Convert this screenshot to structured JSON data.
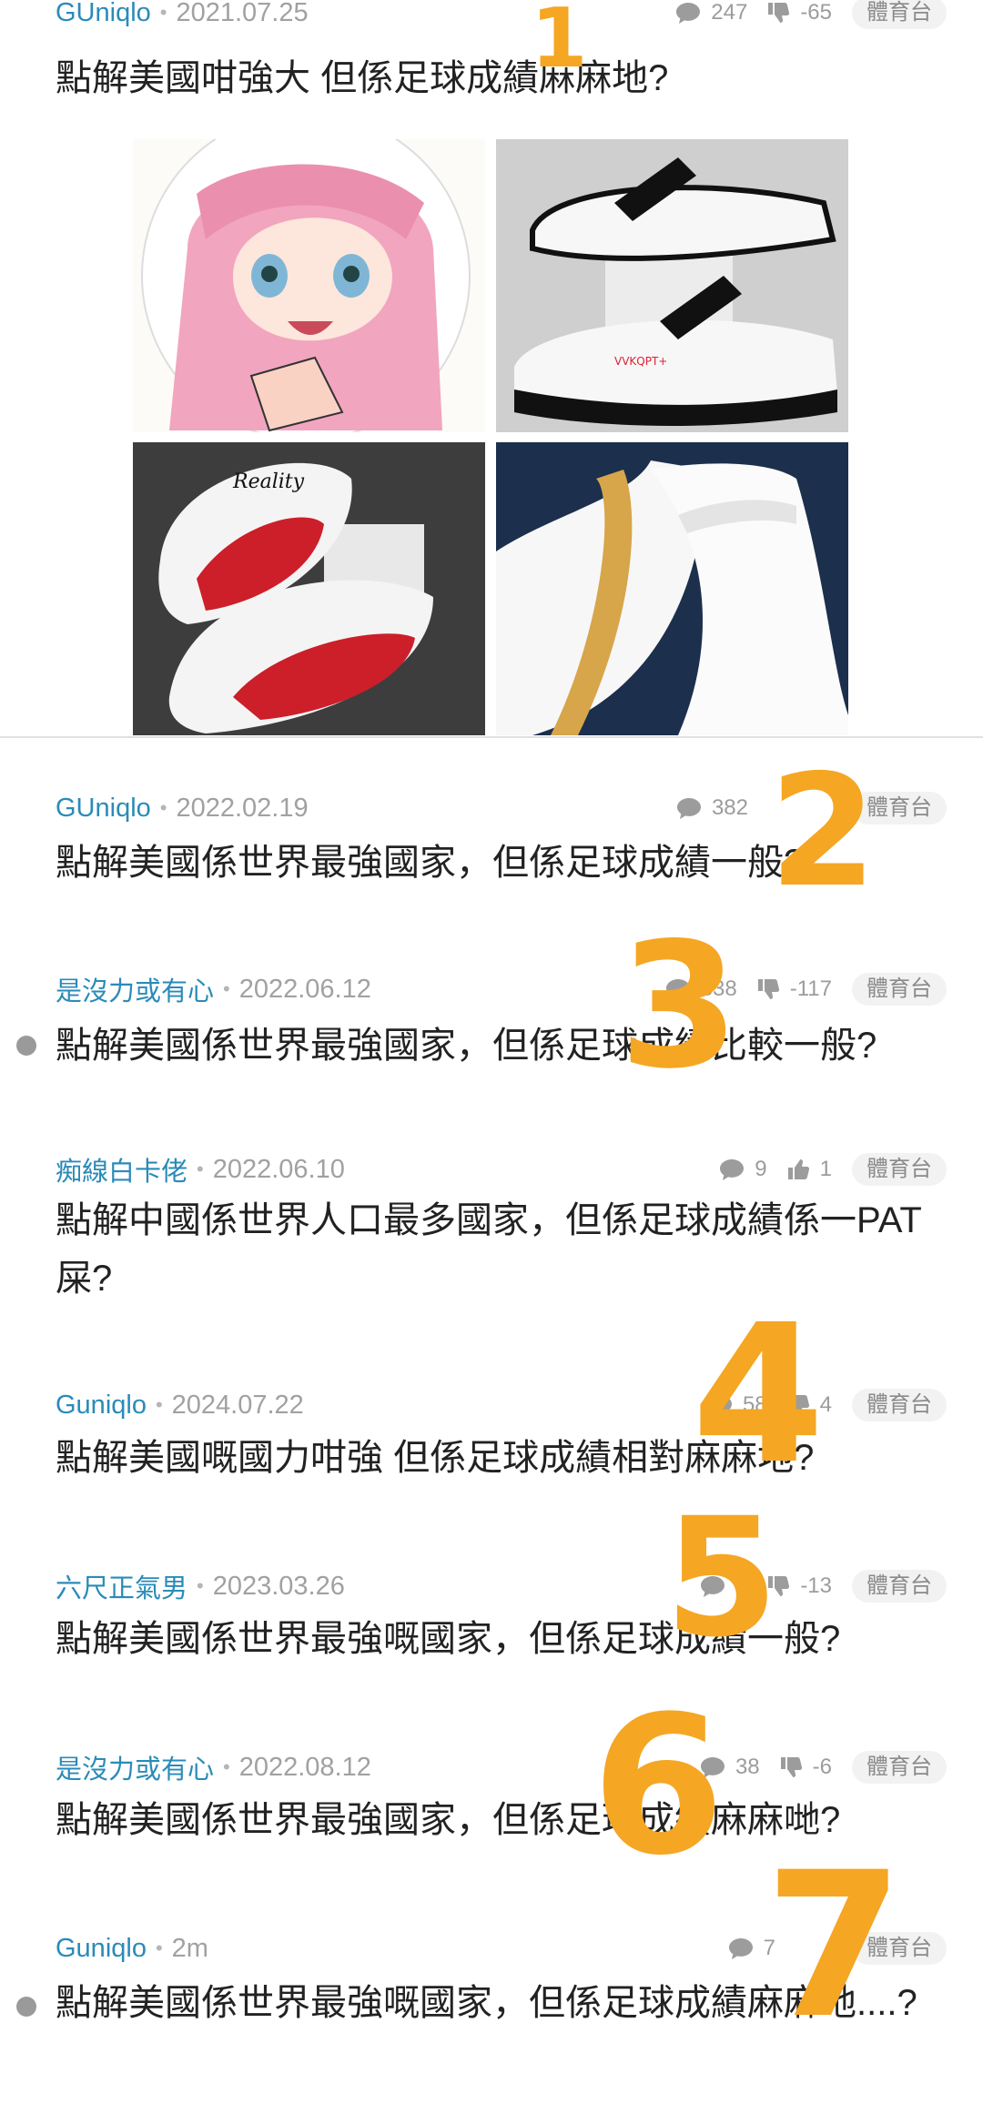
{
  "threads": [
    {
      "author": "GUniqlo",
      "date": "2021.07.25",
      "comments": "247",
      "votes": "-65",
      "vote_type": "down",
      "tag": "體育台",
      "title": "點解美國咁強大 但係足球成績麻麻地?",
      "unread": false
    },
    {
      "author": "GUniqlo",
      "date": "2022.02.19",
      "comments": "382",
      "votes": "",
      "vote_type": "none",
      "tag": "體育台",
      "title": "點解美國係世界最強國家，但係足球成績一般?",
      "unread": false
    },
    {
      "author": "是沒力或有心",
      "date": "2022.06.12",
      "comments": "338",
      "votes": "-117",
      "vote_type": "down",
      "tag": "體育台",
      "title": "點解美國係世界最強國家，但係足球成績比較一般?",
      "unread": true
    },
    {
      "author": "痴線白卡佬",
      "date": "2022.06.10",
      "comments": "9",
      "votes": "1",
      "vote_type": "up",
      "tag": "體育台",
      "title": "點解中國係世界人口最多國家，但係足球成績係一PAT 屎?",
      "unread": false
    },
    {
      "author": "Guniqlo",
      "date": "2024.07.22",
      "comments": "58",
      "votes": "4",
      "vote_type": "down",
      "tag": "體育台",
      "title": "點解美國嘅國力咁強 但係足球成績相對麻麻地?",
      "unread": false
    },
    {
      "author": "六尺正氣男",
      "date": "2023.03.26",
      "comments": "4",
      "votes": "-13",
      "vote_type": "down",
      "tag": "體育台",
      "title": "點解美國係世界最強嘅國家，但係足球成績一般?",
      "unread": false
    },
    {
      "author": "是沒力或有心",
      "date": "2022.08.12",
      "comments": "38",
      "votes": "-6",
      "vote_type": "down",
      "tag": "體育台",
      "title": "點解美國係世界最強國家，但係足球成績麻麻哋?",
      "unread": false
    },
    {
      "author": "Guniqlo",
      "date": "2m",
      "comments": "7",
      "votes": "",
      "vote_type": "none",
      "tag": "體育台",
      "title": "點解美國係世界最強嘅國家，但係足球成績麻麻地....?",
      "unread": true
    }
  ],
  "gallery": {
    "images": [
      "anime-girl-image",
      "white-clog-image",
      "red-slide-image",
      "white-sneaker-image"
    ],
    "slide_brand": "Reality",
    "clog_brand": "VVKQPT+"
  },
  "doodles": [
    "1",
    "2",
    "3",
    "4",
    "5",
    "6",
    "7"
  ],
  "colors": {
    "author": "#2a8bb8",
    "doodle": "#f5a623",
    "divider": "#e1e1e1"
  }
}
